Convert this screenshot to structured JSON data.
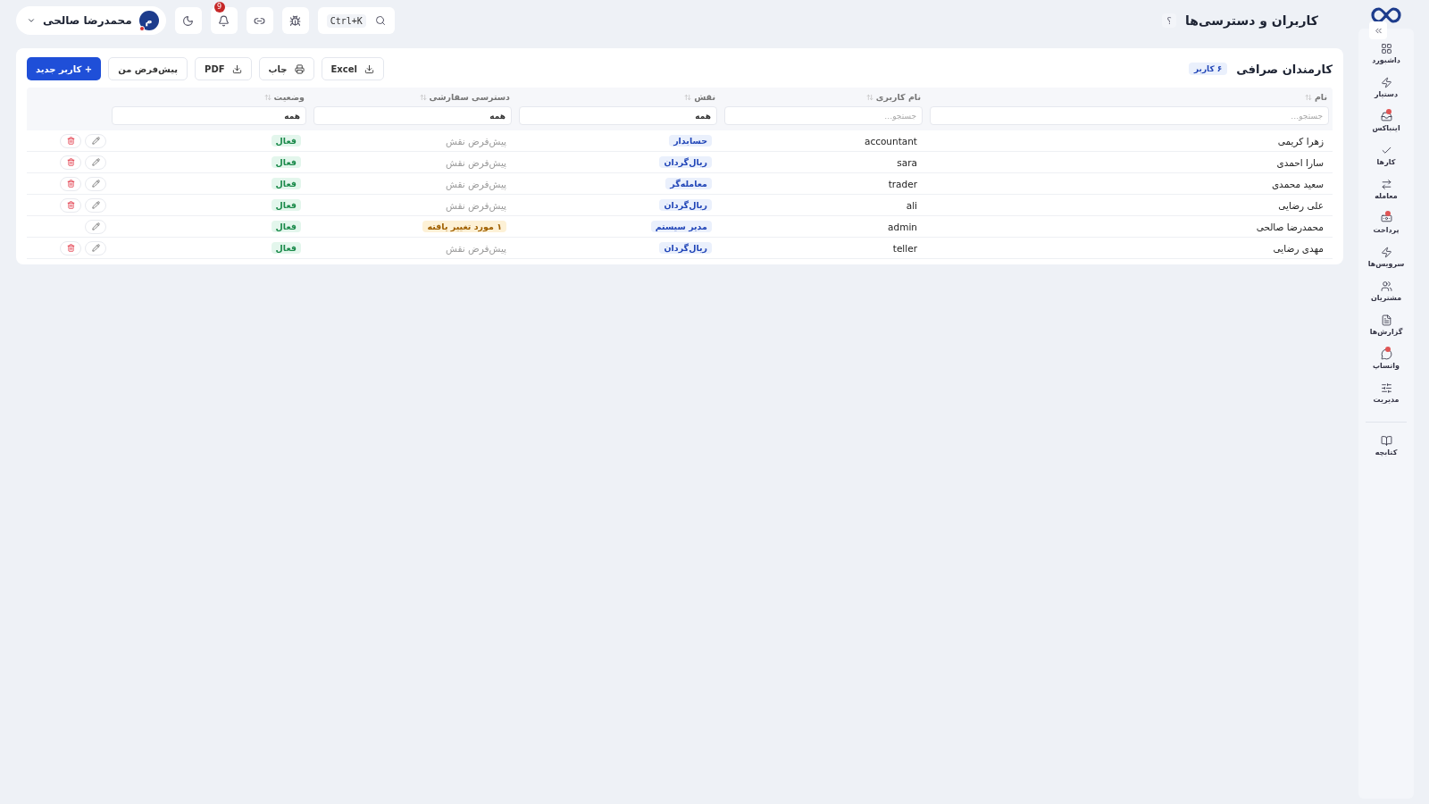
{
  "header": {
    "title": "کاربران و دسترسی‌ها",
    "help": "؟"
  },
  "topbar": {
    "search": {
      "shortcut": "Ctrl+K"
    },
    "notifications": {
      "count": "9"
    },
    "user": {
      "name": "محمدرضا صالحی",
      "initial": "م",
      "online": true
    }
  },
  "sidebar": {
    "items": [
      {
        "label": "داشبورد",
        "dot": false
      },
      {
        "label": "دستیار",
        "dot": false
      },
      {
        "label": "اینباکس",
        "dot": true
      },
      {
        "label": "کارها",
        "dot": false
      },
      {
        "label": "معامله",
        "dot": false
      },
      {
        "label": "پرداخت",
        "dot": true
      },
      {
        "label": "سرویس‌ها",
        "dot": false
      },
      {
        "label": "مشتریان",
        "dot": false
      },
      {
        "label": "گزارش‌ها",
        "dot": false
      },
      {
        "label": "واتساپ",
        "dot": true
      },
      {
        "label": "مدیریت",
        "dot": false
      }
    ],
    "footer": [
      {
        "label": "کتابچه",
        "dot": false
      }
    ]
  },
  "card": {
    "title": "کارمندان صرافی",
    "count": "۶ کاربر",
    "toolbar": [
      {
        "label": "Excel",
        "kind": "download"
      },
      {
        "label": "چاپ",
        "kind": "print"
      },
      {
        "label": "PDF",
        "kind": "download"
      },
      {
        "label": "پیش‌فرض من",
        "kind": "plain"
      },
      {
        "label": "+ کاربر جدید",
        "kind": "primary"
      }
    ],
    "columns": [
      {
        "label": "نام",
        "filter": {
          "kind": "search",
          "placeholder": "جستجو…"
        }
      },
      {
        "label": "نام کاربری",
        "filter": {
          "kind": "search",
          "placeholder": "جستجو…"
        }
      },
      {
        "label": "نقش",
        "filter": {
          "kind": "select",
          "value": "همه"
        }
      },
      {
        "label": "دسترسی سفارشی",
        "filter": {
          "kind": "select",
          "value": "همه"
        }
      },
      {
        "label": "وضعیت",
        "filter": {
          "kind": "select",
          "value": "همه"
        }
      }
    ],
    "rows": [
      {
        "name": "زهرا کریمی",
        "username": "accountant",
        "role": "حسابدار",
        "access": {
          "text": "پیش‌فرض نقش",
          "kind": "default"
        },
        "status": "فعال",
        "deletable": true
      },
      {
        "name": "سارا احمدی",
        "username": "sara",
        "role": "ریال‌گردان",
        "access": {
          "text": "پیش‌فرض نقش",
          "kind": "default"
        },
        "status": "فعال",
        "deletable": true
      },
      {
        "name": "سعید محمدی",
        "username": "trader",
        "role": "معامله‌گر",
        "access": {
          "text": "پیش‌فرض نقش",
          "kind": "default"
        },
        "status": "فعال",
        "deletable": true
      },
      {
        "name": "علی رضایی",
        "username": "ali",
        "role": "ریال‌گردان",
        "access": {
          "text": "پیش‌فرض نقش",
          "kind": "default"
        },
        "status": "فعال",
        "deletable": true
      },
      {
        "name": "محمدرضا صالحی",
        "username": "admin",
        "role": "مدیر سیستم",
        "access": {
          "text": "۱ مورد تغییر یافته",
          "kind": "changed"
        },
        "status": "فعال",
        "deletable": false
      },
      {
        "name": "مهدی رضایی",
        "username": "teller",
        "role": "ریال‌گردان",
        "access": {
          "text": "پیش‌فرض نقش",
          "kind": "default"
        },
        "status": "فعال",
        "deletable": true
      }
    ]
  }
}
